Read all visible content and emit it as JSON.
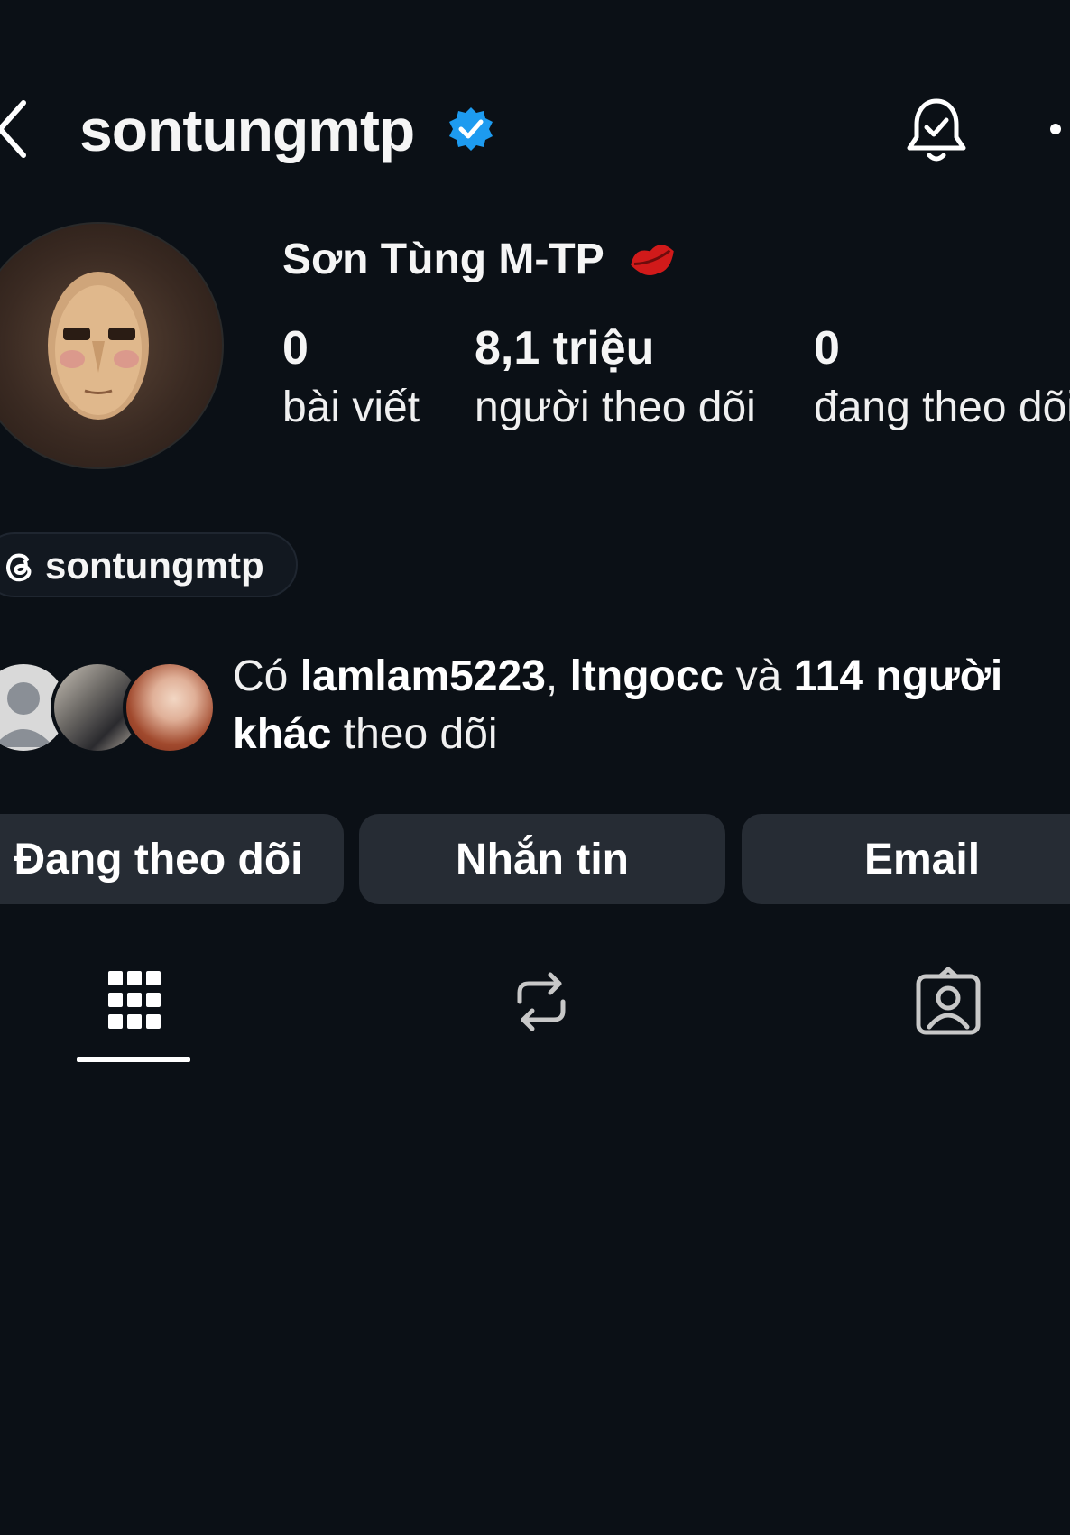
{
  "header": {
    "username": "sontungmtp",
    "back_icon": "chevron-left-icon",
    "verified_icon": "verified-badge-icon",
    "notification_icon": "bell-check-icon",
    "more_icon": "more-dots-icon"
  },
  "profile": {
    "display_name": "Sơn Tùng M-TP",
    "name_emoji_icon": "kiss-lips-icon",
    "stats": [
      {
        "value": "0",
        "label": "bài viết"
      },
      {
        "value": "8,1 triệu",
        "label": "người theo dõi"
      },
      {
        "value": "0",
        "label": "đang theo dõi"
      }
    ]
  },
  "threads": {
    "icon": "threads-icon",
    "handle": "sontungmtp"
  },
  "mutual": {
    "prefix": "Có ",
    "user1": "lamlam5223",
    "sep": ", ",
    "user2": "ltngocc",
    "mid": " và ",
    "others": "114 người khác",
    "suffix": " theo dõi"
  },
  "actions": {
    "following": "Đang theo dõi",
    "message": "Nhắn tin",
    "email": "Email"
  },
  "tabs": [
    {
      "name": "posts",
      "icon": "grid-icon",
      "active": true
    },
    {
      "name": "reposts",
      "icon": "repost-icon",
      "active": false
    },
    {
      "name": "tagged",
      "icon": "tagged-person-icon",
      "active": false
    }
  ],
  "colors": {
    "background": "#0b1016",
    "button": "#262c34",
    "verified": "#1d9bf0",
    "lips": "#d11a1a"
  }
}
